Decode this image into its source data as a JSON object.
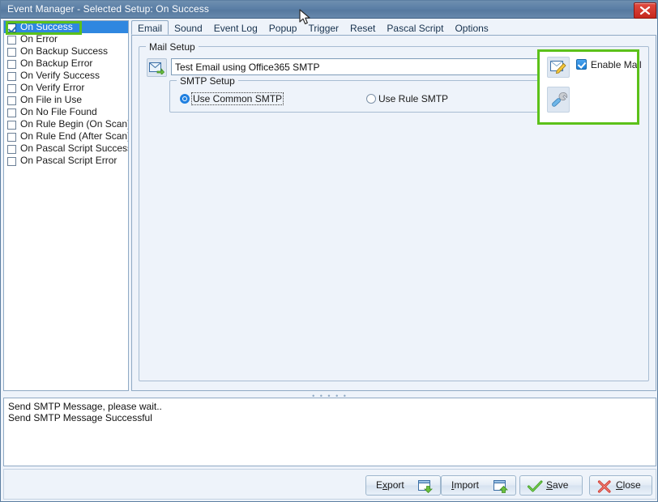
{
  "window": {
    "title": "Event Manager - Selected Setup: On Success",
    "close_icon": "close-icon"
  },
  "sidebar": {
    "items": [
      {
        "label": "On Success",
        "checked": true,
        "selected": true
      },
      {
        "label": "On Error",
        "checked": false,
        "selected": false
      },
      {
        "label": "On Backup Success",
        "checked": false,
        "selected": false
      },
      {
        "label": "On Backup Error",
        "checked": false,
        "selected": false
      },
      {
        "label": "On Verify Success",
        "checked": false,
        "selected": false
      },
      {
        "label": "On Verify Error",
        "checked": false,
        "selected": false
      },
      {
        "label": "On File in Use",
        "checked": false,
        "selected": false
      },
      {
        "label": "On No File Found",
        "checked": false,
        "selected": false
      },
      {
        "label": "On Rule Begin (On Scan)",
        "checked": false,
        "selected": false
      },
      {
        "label": "On Rule End (After Scan)",
        "checked": false,
        "selected": false
      },
      {
        "label": "On Pascal Script Success",
        "checked": false,
        "selected": false
      },
      {
        "label": "On Pascal Script Error",
        "checked": false,
        "selected": false
      }
    ]
  },
  "tabs": [
    {
      "label": "Email",
      "active": true
    },
    {
      "label": "Sound",
      "active": false
    },
    {
      "label": "Event Log",
      "active": false
    },
    {
      "label": "Popup",
      "active": false
    },
    {
      "label": "Trigger",
      "active": false
    },
    {
      "label": "Reset",
      "active": false
    },
    {
      "label": "Pascal Script",
      "active": false
    },
    {
      "label": "Options",
      "active": false
    }
  ],
  "mail_setup": {
    "group_title": "Mail Setup",
    "send_icon": "send-mail-icon",
    "subject_value": "Test Email using Office365 SMTP",
    "subject_placeholder": "",
    "smtp_group_title": "SMTP Setup",
    "radios": [
      {
        "label": "Use Common SMTP",
        "selected": true,
        "focused": true
      },
      {
        "label": "Use Rule SMTP",
        "selected": false,
        "focused": false
      }
    ]
  },
  "mail_options": {
    "edit_icon": "edit-mail-icon",
    "wrench_icon": "wrench-icon",
    "enable_mail_label": "Enable Mail",
    "enable_mail_checked": true,
    "highlight_color": "#5cc11a"
  },
  "status_log": {
    "lines": [
      "Send SMTP Message, please wait..",
      "Send SMTP Message Successful"
    ]
  },
  "footer": {
    "buttons": [
      {
        "label": "Export",
        "accel": "x",
        "icon": "export-window-icon"
      },
      {
        "label": "Import",
        "accel": "I",
        "icon": "import-window-icon"
      },
      {
        "label": "Save",
        "accel": "S",
        "icon": "green-check-icon"
      },
      {
        "label": "Close",
        "accel": "C",
        "icon": "red-x-icon"
      }
    ]
  },
  "colors": {
    "titlebar": "#5b7fa6",
    "selection": "#2f87e0",
    "panel": "#eef3fa",
    "accent_green": "#5cc11a",
    "close_red": "#c5271d"
  }
}
